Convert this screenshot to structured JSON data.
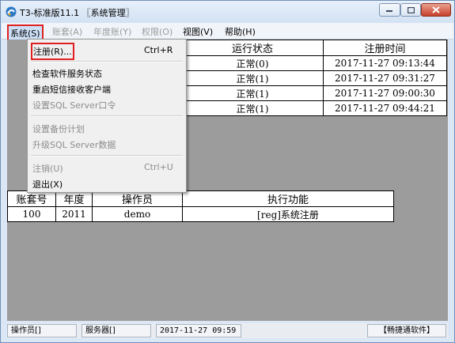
{
  "window": {
    "title": "T3-标准版11.1 〖系统管理〗"
  },
  "menubar": [
    {
      "label": "系统(S)",
      "state": "selected"
    },
    {
      "label": "账套(A)",
      "state": "disabled"
    },
    {
      "label": "年度账(Y)",
      "state": "disabled"
    },
    {
      "label": "权限(O)",
      "state": "disabled"
    },
    {
      "label": "视图(V)",
      "state": "enabled"
    },
    {
      "label": "帮助(H)",
      "state": "enabled"
    }
  ],
  "dropdown": [
    {
      "label": "注册(R)...",
      "shortcut": "Ctrl+R",
      "disabled": false,
      "highlighted": true
    },
    {
      "label": "检查软件服务状态",
      "shortcut": "",
      "disabled": false
    },
    {
      "label": "重启短信接收客户端",
      "shortcut": "",
      "disabled": false
    },
    {
      "label": "设置SQL Server口令",
      "shortcut": "",
      "disabled": true
    },
    {
      "label": "设置备份计划",
      "shortcut": "",
      "disabled": true
    },
    {
      "label": "升级SQL Server数据",
      "shortcut": "",
      "disabled": true
    },
    {
      "label": "注销(U)",
      "shortcut": "Ctrl+U",
      "disabled": true
    },
    {
      "label": "退出(X)",
      "shortcut": "",
      "disabled": false
    }
  ],
  "sites_table": {
    "headers": [
      "运行状态",
      "注册时间"
    ],
    "rows": [
      [
        "正常(0)",
        "2017-11-27 09:13:44"
      ],
      [
        "正常(1)",
        "2017-11-27 09:31:27"
      ],
      [
        "正常(1)",
        "2017-11-27 09:00:30"
      ],
      [
        "正常(1)",
        "2017-11-27 09:44:21"
      ]
    ]
  },
  "tasks_table": {
    "headers": [
      "账套号",
      "年度",
      "操作员",
      "执行功能"
    ],
    "rows": [
      [
        "100",
        "2011",
        "demo",
        "[reg]系统注册"
      ]
    ]
  },
  "statusbar": {
    "operator": "操作员[]",
    "server": "服务器[]",
    "datetime": "2017-11-27 09:59",
    "brand": "【畅捷通软件】"
  },
  "colors": {
    "highlight_border": "#e02020",
    "client_bg": "#9c9c9c"
  }
}
